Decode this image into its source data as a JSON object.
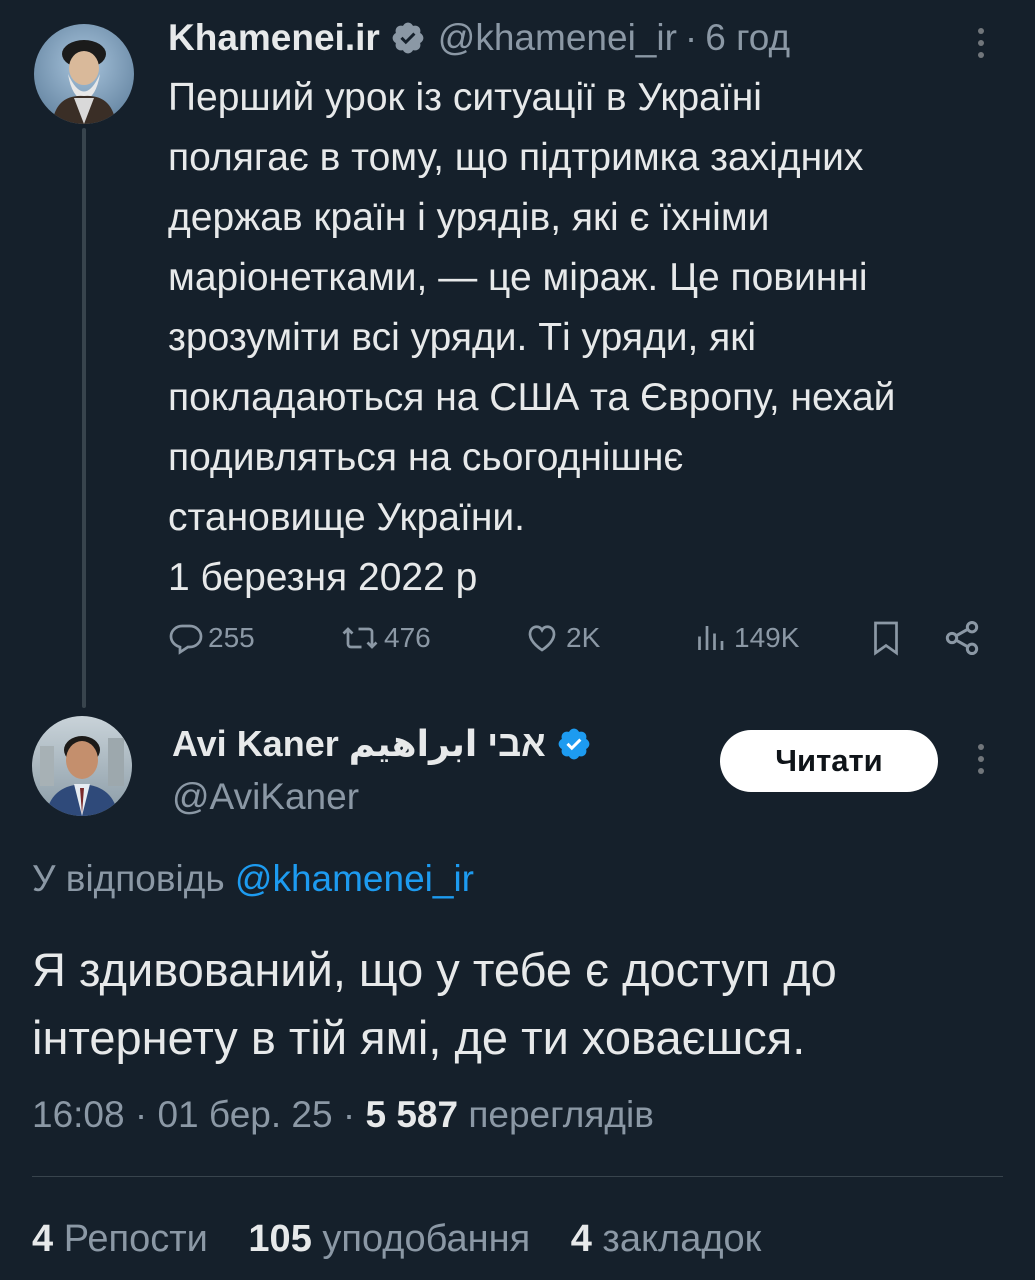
{
  "quoted_tweet": {
    "author_name": "Khamenei.ir",
    "handle": "@khamenei_ir",
    "separator": "·",
    "time": "6 год",
    "text_lines": [
      "Перший урок із ситуації в Україні",
      "полягає в тому, що підтримка західних",
      "держав країн і урядів, які є їхніми",
      "маріонетками, — це міраж. Це повинні",
      "зрозуміти всі уряди. Ті уряди, які",
      "покладаються на США та Європу, нехай",
      "подивляться на сьогоднішнє",
      "становище України."
    ],
    "date_line": "1 березня 2022 р",
    "replies": "255",
    "reposts": "476",
    "likes": "2K",
    "views": "149K"
  },
  "reply_tweet": {
    "author_name": "Avi Kaner אבי ابراهيم",
    "handle": "@AviKaner",
    "follow_label": "Читати",
    "reply_to_prefix": "У відповідь",
    "reply_to_handle": "@khamenei_ir",
    "text_lines": [
      "Я здивований, що у тебе є доступ до",
      "інтернету в тій ямі, де ти ховаєшся."
    ],
    "time": "16:08",
    "sep1": "·",
    "date": "01 бер. 25",
    "sep2": "·",
    "views_count": "5 587",
    "views_label": "переглядів"
  },
  "stats": {
    "reposts_count": "4",
    "reposts_label": "Репости",
    "likes_count": "105",
    "likes_label": "уподобання",
    "bookmarks_count": "4",
    "bookmarks_label": "закладок"
  },
  "colors": {
    "background": "#15202b",
    "text": "#e7e9ea",
    "muted": "#8b98a5",
    "link": "#1d9bf0",
    "verified": "#1d9bf0"
  }
}
